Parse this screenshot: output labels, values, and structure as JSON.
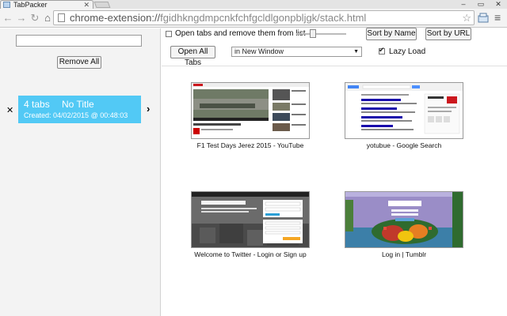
{
  "browser": {
    "tab_title": "TabPacker",
    "url_host": "chrome-extension://",
    "url_path": "fgidhkngdmpcnkfchfgcldlgonpbljgk/stack.html"
  },
  "sidebar": {
    "search_placeholder": "",
    "remove_all_label": "Remove All",
    "session": {
      "count": "4 tabs",
      "title": "No Title",
      "created": "Created: 04/02/2015 @ 00:48:03"
    }
  },
  "controls": {
    "open_remove_label": "Open tabs and remove them from list",
    "open_remove_checked": false,
    "sort_name_label": "Sort by Name",
    "sort_url_label": "Sort by URL",
    "open_all_label": "Open All Tabs",
    "open_target_value": "in New Window",
    "lazy_load_label": "Lazy Load",
    "lazy_load_checked": true
  },
  "tabs": [
    {
      "caption": "F1 Test Days Jerez 2015 - YouTube",
      "icon": "youtube-thumbnail"
    },
    {
      "caption": "yotubue - Google Search",
      "icon": "google-thumbnail"
    },
    {
      "caption": "Welcome to Twitter - Login or Sign up",
      "icon": "twitter-thumbnail"
    },
    {
      "caption": "Log in | Tumblr",
      "icon": "tumblr-thumbnail"
    }
  ]
}
